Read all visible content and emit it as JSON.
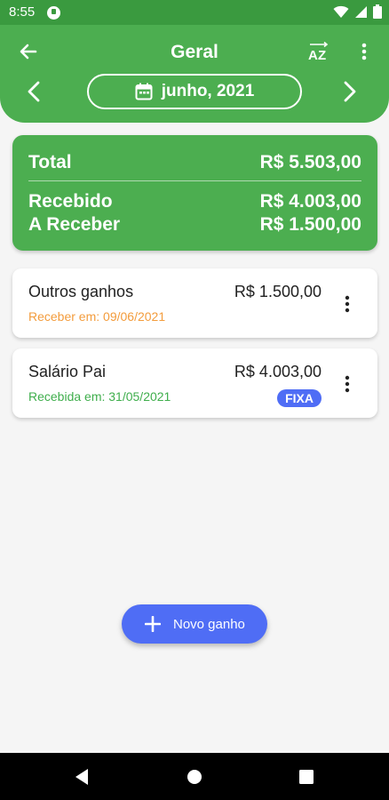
{
  "status": {
    "time": "8:55"
  },
  "appbar": {
    "title": "Geral",
    "month": "junho, 2021"
  },
  "summary": {
    "total_label": "Total",
    "total_value": "R$ 5.503,00",
    "received_label": "Recebido",
    "received_value": "R$ 4.003,00",
    "toreceive_label": "A Receber",
    "toreceive_value": "R$ 1.500,00"
  },
  "items": [
    {
      "name": "Outros ganhos",
      "value": "R$ 1.500,00",
      "date": "Receber em: 09/06/2021",
      "date_color": "#f39c3c",
      "badge": ""
    },
    {
      "name": "Salário Pai",
      "value": "R$ 4.003,00",
      "date": "Recebida em: 31/05/2021",
      "date_color": "#3fae4c",
      "badge": "FIXA"
    }
  ],
  "fab": {
    "label": "Novo ganho"
  },
  "colors": {
    "primary": "#4cae50",
    "accent": "#4f6df5",
    "status_bar": "#3a9a3f"
  },
  "icons": [
    "app-notification-icon",
    "wifi-icon",
    "signal-icon",
    "battery-icon",
    "back-arrow-icon",
    "sort-az-icon",
    "more-vert-icon",
    "chevron-left-icon",
    "chevron-right-icon",
    "calendar-icon",
    "plus-icon",
    "nav-back-icon",
    "nav-home-icon",
    "nav-recents-icon"
  ]
}
